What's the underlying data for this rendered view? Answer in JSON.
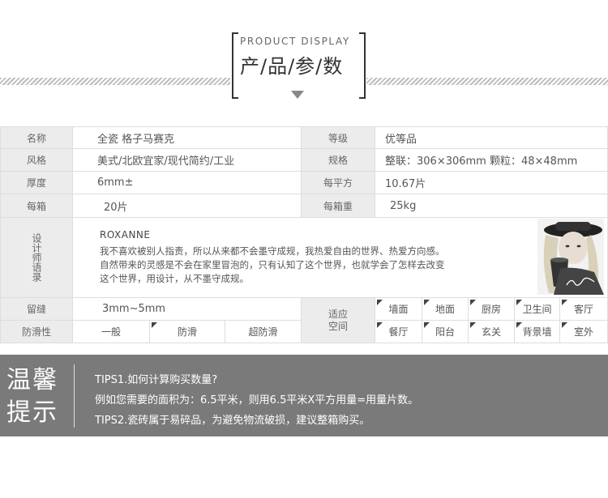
{
  "header": {
    "en": "PRODUCT DISPLAY",
    "cn": "产/品/参/数"
  },
  "specs": {
    "name_label": "名称",
    "name_value": "全瓷 格子马赛克",
    "grade_label": "等级",
    "grade_value": "优等品",
    "style_label": "风格",
    "style_value": "美式/北欧宜家/现代简约/工业",
    "size_label": "规格",
    "size_value": "整联：306×306mm 颗粒：48×48mm",
    "thick_label": "厚度",
    "thick_value": "6mm±",
    "per_sqm_label": "每平方",
    "per_sqm_value": "10.67片",
    "per_box_label": "每箱",
    "per_box_value": "20片",
    "box_weight_label": "每箱重",
    "box_weight_value": "25kg"
  },
  "designer": {
    "label": "设计师语录",
    "name": "ROXANNE",
    "line1": "我不喜欢被别人指责，所以从来都不会墨守成规，我热爱自由的世界、热爱方向感。",
    "line2": "自然带来的灵感是不会在家里冒泡的，只有认知了这个世界，也就学会了怎样去改变",
    "line3": "这个世界，用设计，从不墨守成规。"
  },
  "grout": {
    "label": "留缝",
    "value": "3mm~5mm"
  },
  "slip": {
    "label": "防滑性",
    "options": [
      "一般",
      "防滑",
      "超防滑"
    ]
  },
  "usage": {
    "label_1": "适应",
    "label_2": "空间",
    "row1": [
      "墙面",
      "地面",
      "厨房",
      "卫生间",
      "客厅"
    ],
    "row2": [
      "餐厅",
      "阳台",
      "玄关",
      "背景墙",
      "室外"
    ]
  },
  "tips": {
    "title_1": "温馨",
    "title_2": "提示",
    "tip1": "TIPS1.如何计算购买数量?",
    "tip1_detail": "例如您需要的面积为：6.5平米，则用6.5平米X平方用量=用量片数。",
    "tip2": "TIPS2.瓷砖属于易碎品，为避免物流破损，建议整箱购买。"
  }
}
